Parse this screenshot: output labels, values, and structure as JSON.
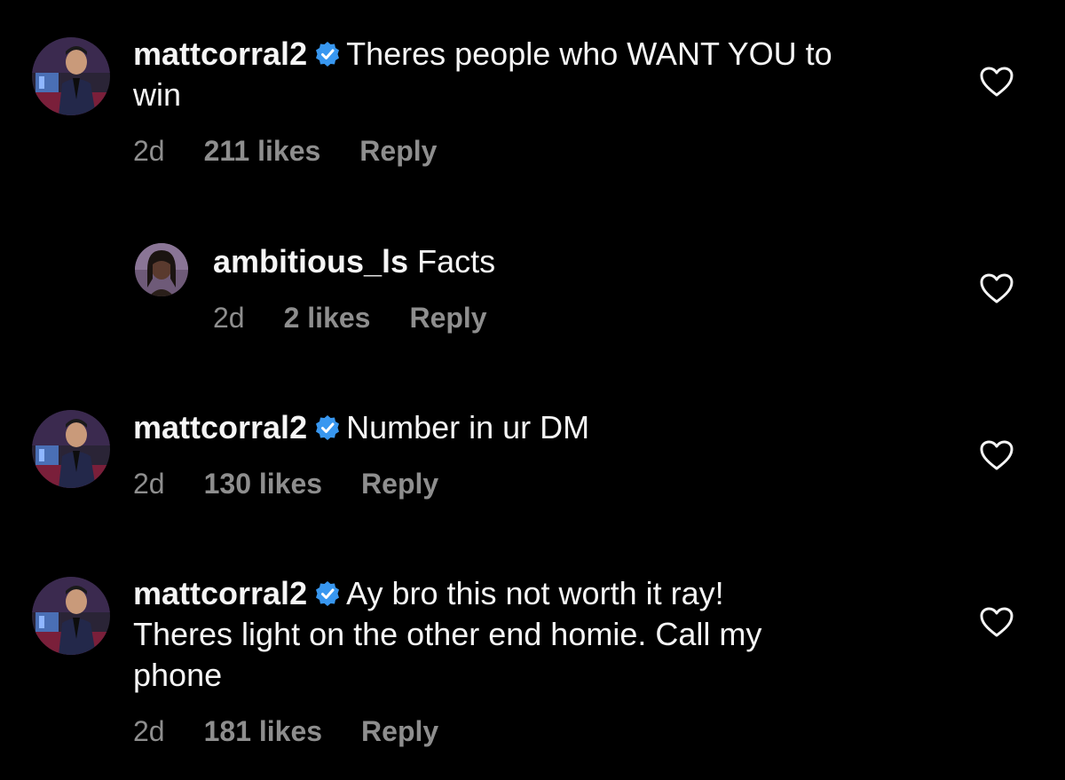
{
  "comments": [
    {
      "username": "mattcorral2",
      "verified": true,
      "text": "Theres people who WANT YOU to",
      "text_cont": "win",
      "age": "2d",
      "likes": "211 likes",
      "reply": "Reply"
    },
    {
      "username": "ambitious_ls",
      "verified": false,
      "text": "Facts",
      "age": "2d",
      "likes": "2 likes",
      "reply": "Reply"
    },
    {
      "username": "mattcorral2",
      "verified": true,
      "text": "Number in ur DM",
      "age": "2d",
      "likes": "130 likes",
      "reply": "Reply"
    },
    {
      "username": "mattcorral2",
      "verified": true,
      "text": "Ay bro this not worth it ray!",
      "text_cont": "Theres light on the other end homie. Call my",
      "text_cont2": "phone",
      "age": "2d",
      "likes": "181 likes",
      "reply": "Reply"
    }
  ],
  "colors": {
    "background": "#000000",
    "text": "#f5f5f5",
    "meta": "#8e8e8e",
    "verified_badge": "#3897f0"
  },
  "icons": {
    "verified": "verified-badge-icon",
    "like": "heart-outline-icon"
  }
}
